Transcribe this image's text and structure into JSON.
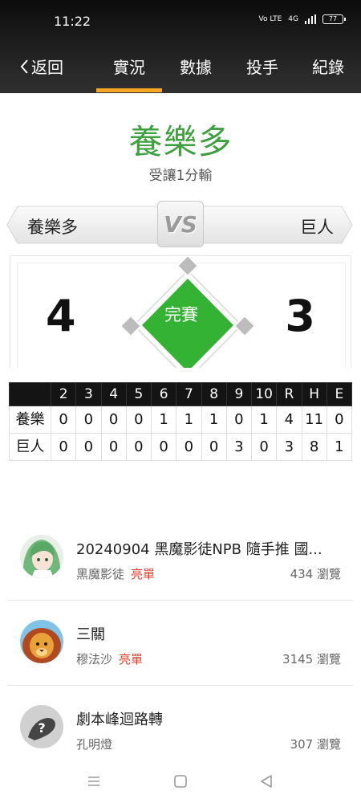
{
  "status": {
    "time": "11:22",
    "volte": "Vo LTE",
    "network": "4G",
    "battery": "77"
  },
  "nav": {
    "back_label": "返回",
    "tabs": [
      {
        "label": "實況",
        "active": true
      },
      {
        "label": "數據",
        "active": false
      },
      {
        "label": "投手",
        "active": false
      },
      {
        "label": "紀錄",
        "active": false
      }
    ]
  },
  "result": {
    "winner": "養樂多",
    "subtitle": "受讓1分輸"
  },
  "teams": {
    "away": "養樂多",
    "vs": "VS",
    "home": "巨人"
  },
  "score": {
    "away": "4",
    "home": "3",
    "status": "完賽"
  },
  "linescore": {
    "headers": [
      "",
      "2",
      "3",
      "4",
      "5",
      "6",
      "7",
      "8",
      "9",
      "10",
      "R",
      "H",
      "E"
    ],
    "rows": [
      {
        "team": "養樂多",
        "cells": [
          "0",
          "0",
          "0",
          "0",
          "1",
          "1",
          "1",
          "0",
          "1",
          "4",
          "11",
          "0"
        ]
      },
      {
        "team": "巨人",
        "cells": [
          "0",
          "0",
          "0",
          "0",
          "0",
          "0",
          "0",
          "3",
          "0",
          "3",
          "8",
          "1"
        ]
      }
    ]
  },
  "posts": [
    {
      "title": "20240904 黑魔影徒NPB 隨手推 國...",
      "author": "黑魔影徒",
      "tag": "亮單",
      "views": "434 瀏覽",
      "avatar": "anime-girl-avatar"
    },
    {
      "title": "三關",
      "author": "穆法沙",
      "tag": "亮單",
      "views": "3145 瀏覽",
      "avatar": "lion-avatar"
    },
    {
      "title": "劇本峰迴路轉",
      "author": "孔明燈",
      "tag": "",
      "views": "307 瀏覽",
      "avatar": "default-avatar"
    }
  ],
  "colors": {
    "accent": "#f5a623",
    "win_green": "#3fa040",
    "tag_red": "#e2402d",
    "field_green": "#33b233"
  }
}
